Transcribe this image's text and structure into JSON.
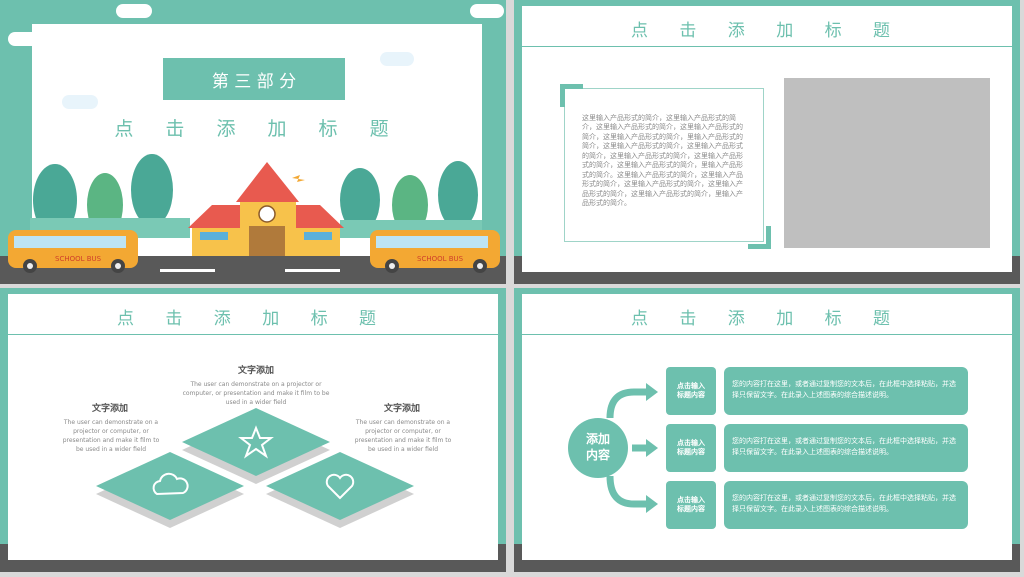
{
  "slide1": {
    "section_label": "第 三 部 分",
    "title": "点 击 添 加 标 题",
    "bus_label": "SCHOOL BUS"
  },
  "slide2": {
    "title": "点 击 添 加 标 题",
    "paragraph": "这里输入产品形式的简介，这里输入产品形式的简介，这里输入产品形式的简介，这里输入产品形式的简介，这里输入产品形式的简介，里输入产品形式的简介，这里输入产品形式的简介，这里输入产品形式的简介，这里输入产品形式的简介，这里输入产品形式的简介，这里输入产品形式的简介，里输入产品形式的简介。这里输入产品形式的简介，这里输入产品形式的简介，这里输入产品形式的简介，这里输入产品形式的简介，这里输入产品形式的简介，里输入产品形式的简介。"
  },
  "slide3": {
    "title": "点 击 添 加 标 题",
    "items": [
      {
        "heading": "文字添加",
        "text": "The user can demonstrate on a projector or computer, or presentation and make it film to be used in a wider field"
      },
      {
        "heading": "文字添加",
        "text": "The user can demonstrate on a projector or computer, or presentation and make it film to be used in a wider field"
      },
      {
        "heading": "文字添加",
        "text": "The user can demonstrate on a projector or computer, or presentation and make it film to be used in a wider field"
      }
    ]
  },
  "slide4": {
    "title": "点 击 添 加 标 题",
    "center_label": "添加\n内容",
    "rows": [
      {
        "label": "点击输入\n标题内容",
        "text": "您的内容打在这里，或者通过复制您的文本后，在此框中选择粘贴，并选择只保留文字。在此录入上述图表的综合描述说明。"
      },
      {
        "label": "点击输入\n标题内容",
        "text": "您的内容打在这里，或者通过复制您的文本后，在此框中选择粘贴，并选择只保留文字。在此录入上述图表的综合描述说明。"
      },
      {
        "label": "点击输入\n标题内容",
        "text": "您的内容打在这里，或者通过复制您的文本后，在此框中选择粘贴，并选择只保留文字。在此录入上述图表的综合描述说明。"
      }
    ]
  },
  "colors": {
    "accent": "#6dc0ae",
    "road": "#595959",
    "bus": "#f3a833",
    "roof": "#e85a4f",
    "building": "#f7c24b"
  }
}
